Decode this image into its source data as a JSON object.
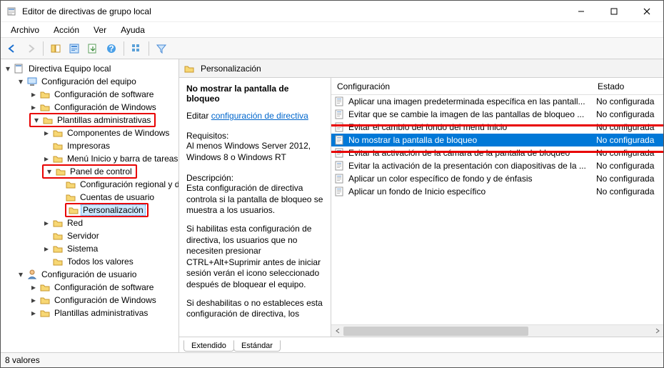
{
  "window": {
    "title": "Editor de directivas de grupo local"
  },
  "menubar": {
    "items": [
      "Archivo",
      "Acción",
      "Ver",
      "Ayuda"
    ]
  },
  "toolbar": {
    "back_icon": "back-arrow-icon",
    "forward_icon": "forward-arrow-icon",
    "up_icon": "folder-up-icon",
    "props_icon": "properties-icon",
    "export_icon": "export-list-icon",
    "help_icon": "help-icon",
    "icons_icon": "icons-view-icon",
    "filter_icon": "filter-icon"
  },
  "tree": {
    "root": "Directiva Equipo local",
    "computer_config": "Configuración del equipo",
    "software_config": "Configuración de software",
    "windows_config": "Configuración de Windows",
    "admin_templates": "Plantillas administrativas",
    "windows_components": "Componentes de Windows",
    "printers": "Impresoras",
    "start_menu_taskbar": "Menú Inicio y barra de tareas",
    "control_panel": "Panel de control",
    "regional_language": "Configuración regional y de",
    "user_accounts": "Cuentas de usuario",
    "personalization": "Personalización",
    "network": "Red",
    "server": "Servidor",
    "system": "Sistema",
    "all_values": "Todos los valores",
    "user_config": "Configuración de usuario",
    "user_software_config": "Configuración de software",
    "user_windows_config": "Configuración de Windows",
    "user_admin_templates": "Plantillas administrativas"
  },
  "right": {
    "header": "Personalización",
    "desc_title": "No mostrar la pantalla de bloqueo",
    "edit_prefix": "Editar",
    "edit_link": "configuración de directiva",
    "req_label": "Requisitos:",
    "req_text": "Al menos Windows Server 2012, Windows 8 o Windows RT",
    "desc_label": "Descripción:",
    "desc_text1": "Esta configuración de directiva controla si la pantalla de bloqueo se muestra a los usuarios.",
    "desc_text2": "Si habilitas esta configuración de directiva, los usuarios que no necesiten presionar CTRL+Alt+Suprimir antes de iniciar sesión verán el icono seleccionado después de bloquear el equipo.",
    "desc_text3": "Si deshabilitas o no estableces esta configuración de directiva, los"
  },
  "columns": {
    "config": "Configuración",
    "state": "Estado"
  },
  "rows": [
    {
      "label": "Aplicar una imagen predeterminada específica en las pantall...",
      "state": "No configurada",
      "selected": false,
      "highlight": false
    },
    {
      "label": "Evitar que se cambie la imagen de las pantallas de bloqueo ...",
      "state": "No configurada",
      "selected": false,
      "highlight": false
    },
    {
      "label": "Evitar el cambio del fondo del menú Inicio",
      "state": "No configurada",
      "selected": false,
      "highlight": false
    },
    {
      "label": "No mostrar la pantalla de bloqueo",
      "state": "No configurada",
      "selected": true,
      "highlight": true
    },
    {
      "label": "Evitar la activación de la cámara de la pantalla de bloqueo",
      "state": "No configurada",
      "selected": false,
      "highlight": false
    },
    {
      "label": "Evitar la activación de la presentación con diapositivas de la ...",
      "state": "No configurada",
      "selected": false,
      "highlight": false
    },
    {
      "label": "Aplicar un color específico de fondo y de énfasis",
      "state": "No configurada",
      "selected": false,
      "highlight": false
    },
    {
      "label": "Aplicar un fondo de Inicio específico",
      "state": "No configurada",
      "selected": false,
      "highlight": false
    }
  ],
  "tabs": {
    "extended": "Extendido",
    "standard": "Estándar"
  },
  "status": {
    "text": "8 valores"
  }
}
